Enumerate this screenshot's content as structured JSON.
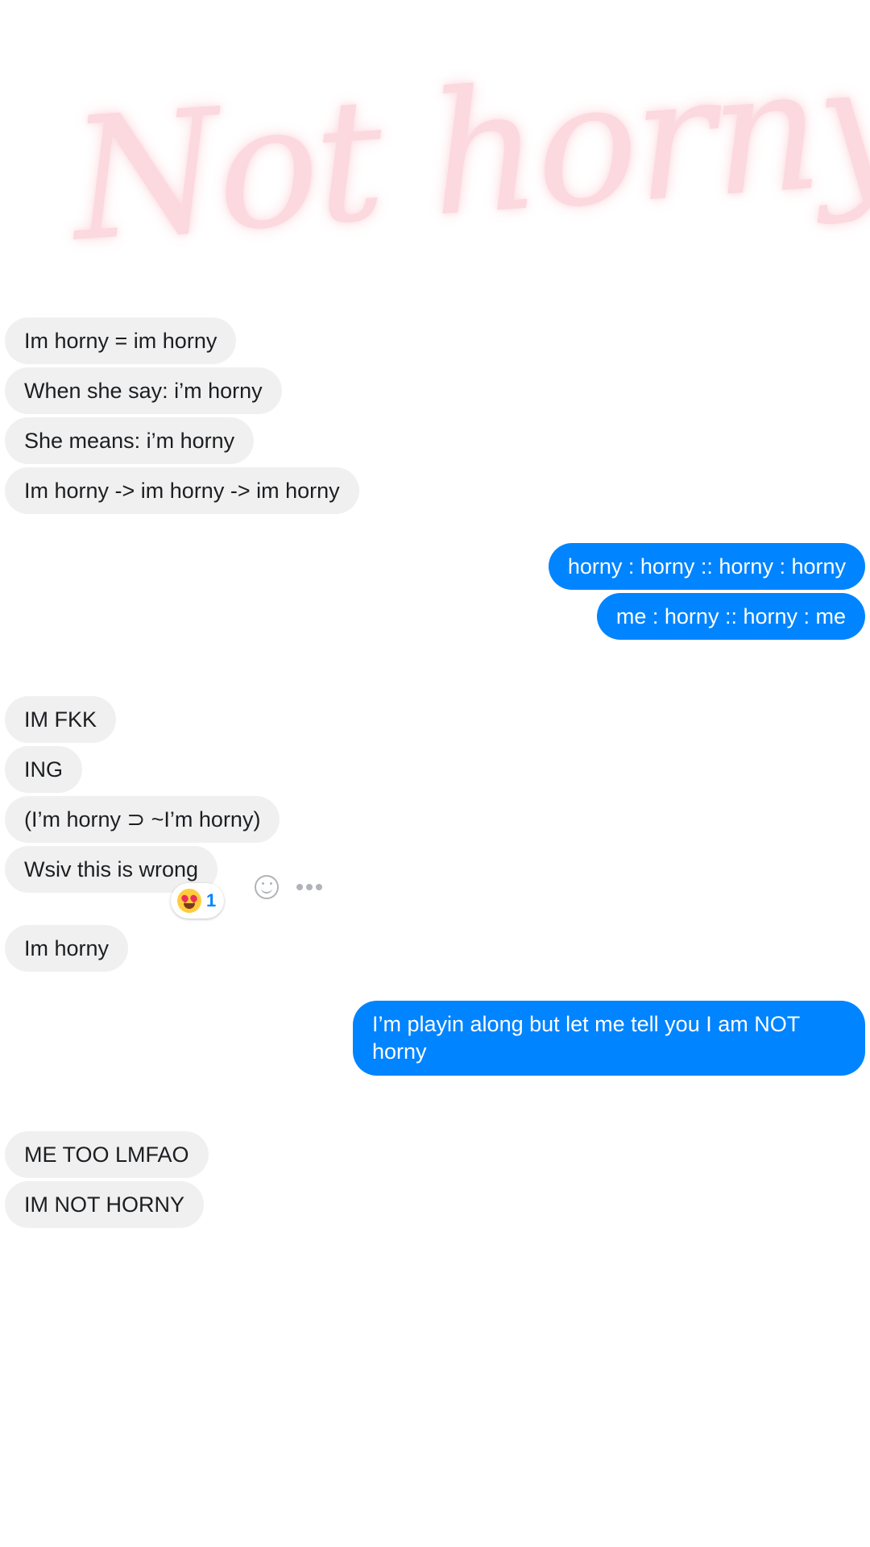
{
  "title": "Not horny",
  "messages": [
    {
      "sender": "them",
      "text": "Im horny = im horny"
    },
    {
      "sender": "them",
      "text": "When she say: i’m horny"
    },
    {
      "sender": "them",
      "text": "She means: i’m horny"
    },
    {
      "sender": "them",
      "text": "Im horny -> im horny -> im horny"
    },
    {
      "sender": "me",
      "text": "horny : horny :: horny : horny"
    },
    {
      "sender": "me",
      "text": "me : horny :: horny : me"
    },
    {
      "sender": "them",
      "text": "IM FKK"
    },
    {
      "sender": "them",
      "text": "ING"
    },
    {
      "sender": "them",
      "text": "(I’m horny ⊃ ~I’m horny)"
    },
    {
      "sender": "them",
      "text": "Wsiv this is wrong"
    },
    {
      "sender": "them",
      "text": "Im horny"
    },
    {
      "sender": "me",
      "text": "I’m playin along but let me tell you I am NOT horny"
    },
    {
      "sender": "them",
      "text": "ME TOO LMFAO"
    },
    {
      "sender": "them",
      "text": "IM NOT HORNY"
    }
  ],
  "reaction": {
    "emoji": "heart-eyes-emoji",
    "count": "1"
  },
  "icons": {
    "react": "smiley-icon",
    "more": "more-options-icon"
  },
  "colors": {
    "outgoing": "#0084ff",
    "incoming": "#f0f0f0",
    "title": "#fbd0d6"
  }
}
